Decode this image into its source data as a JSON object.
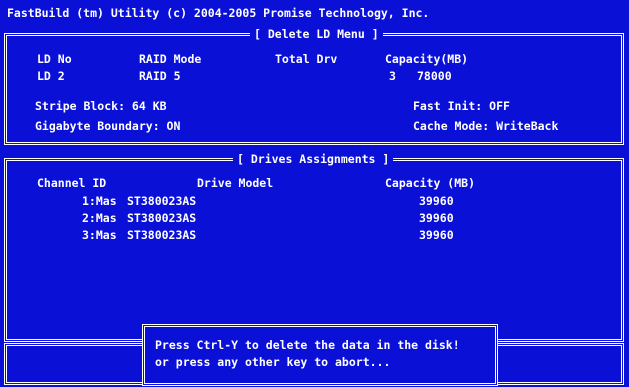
{
  "window": {
    "title": "FastBuild (tm) Utility (c) 2004-2005 Promise Technology, Inc."
  },
  "delete_menu": {
    "title": "[ Delete LD Menu ]",
    "headers": {
      "ld_no": "LD No",
      "raid_mode": "RAID Mode",
      "total_drv": "Total Drv",
      "capacity": "Capacity(MB)"
    },
    "row": {
      "ld_no": "LD 2",
      "raid_mode": "RAID 5",
      "total_drv": "3",
      "capacity": "78000"
    },
    "stripe_block": "Stripe Block: 64 KB",
    "fast_init": "Fast Init: OFF",
    "gigabyte_boundary": "Gigabyte Boundary: ON",
    "cache_mode": "Cache Mode: WriteBack"
  },
  "drives": {
    "title": "[ Drives Assignments ]",
    "headers": {
      "channel_id": "Channel ID",
      "drive_model": "Drive Model",
      "capacity": "Capacity (MB)"
    },
    "rows": [
      {
        "channel": "1:Mas",
        "model": "ST380023AS",
        "capacity": "39960"
      },
      {
        "channel": "2:Mas",
        "model": "ST380023AS",
        "capacity": "39960"
      },
      {
        "channel": "3:Mas",
        "model": "ST380023AS",
        "capacity": "39960"
      }
    ]
  },
  "dialog": {
    "line1": "Press Ctrl-Y to delete the data in the disk!",
    "line2": "or press any other key to abort..."
  },
  "colors": {
    "background": "#0a10d6",
    "text": "#ffffff"
  }
}
